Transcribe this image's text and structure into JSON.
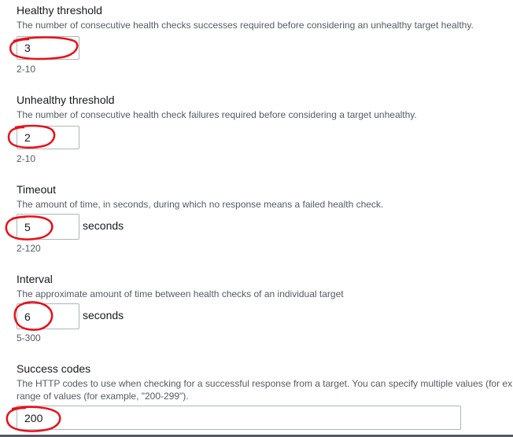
{
  "fields": {
    "healthy_threshold": {
      "label": "Healthy threshold",
      "description": "The number of consecutive health checks successes required before considering an unhealthy target healthy.",
      "value": "3",
      "constraint": "2-10"
    },
    "unhealthy_threshold": {
      "label": "Unhealthy threshold",
      "description": "The number of consecutive health check failures required before considering a target unhealthy.",
      "value": "2",
      "constraint": "2-10"
    },
    "timeout": {
      "label": "Timeout",
      "description": "The amount of time, in seconds, during which no response means a failed health check.",
      "value": "5",
      "suffix": "seconds",
      "constraint": "2-120"
    },
    "interval": {
      "label": "Interval",
      "description": "The approximate amount of time between health checks of an individual target",
      "value": "6",
      "suffix": "seconds",
      "constraint": "5-300"
    },
    "success_codes": {
      "label": "Success codes",
      "description_line1": "The HTTP codes to use when checking for a successful response from a target. You can specify multiple values (for ex",
      "description_line2": "range of values (for example, \"200-299\").",
      "value": "200"
    }
  },
  "colors": {
    "annotation": "#e8101a",
    "input_border": "#aab7b8",
    "description_text": "#545b64"
  }
}
